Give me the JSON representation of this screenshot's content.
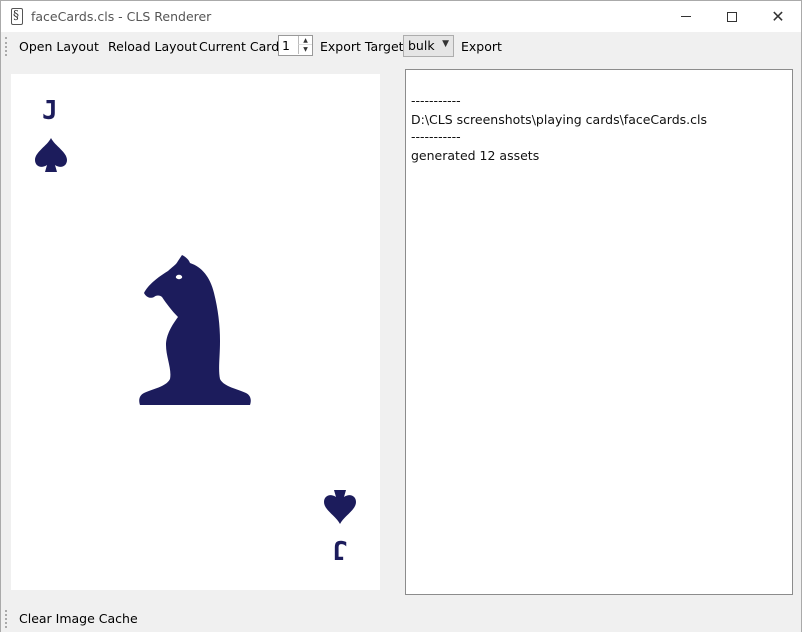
{
  "window": {
    "title": "faceCards.cls - CLS Renderer"
  },
  "toolbar": {
    "open_layout": "Open Layout",
    "reload_layout": "Reload Layout",
    "current_card_label": "Current Card",
    "current_card_value": "1",
    "export_target_label": "Export Target",
    "export_target_value": "bulk",
    "export": "Export"
  },
  "card": {
    "rank": "J",
    "suit": "spade",
    "figure": "knight-chess-piece",
    "ink_color": "#1c1c5c"
  },
  "log": {
    "lines": [
      "-----------",
      "D:\\CLS screenshots\\playing cards\\faceCards.cls",
      "-----------",
      "generated 12 assets"
    ]
  },
  "statusbar": {
    "clear_cache": "Clear Image Cache"
  }
}
